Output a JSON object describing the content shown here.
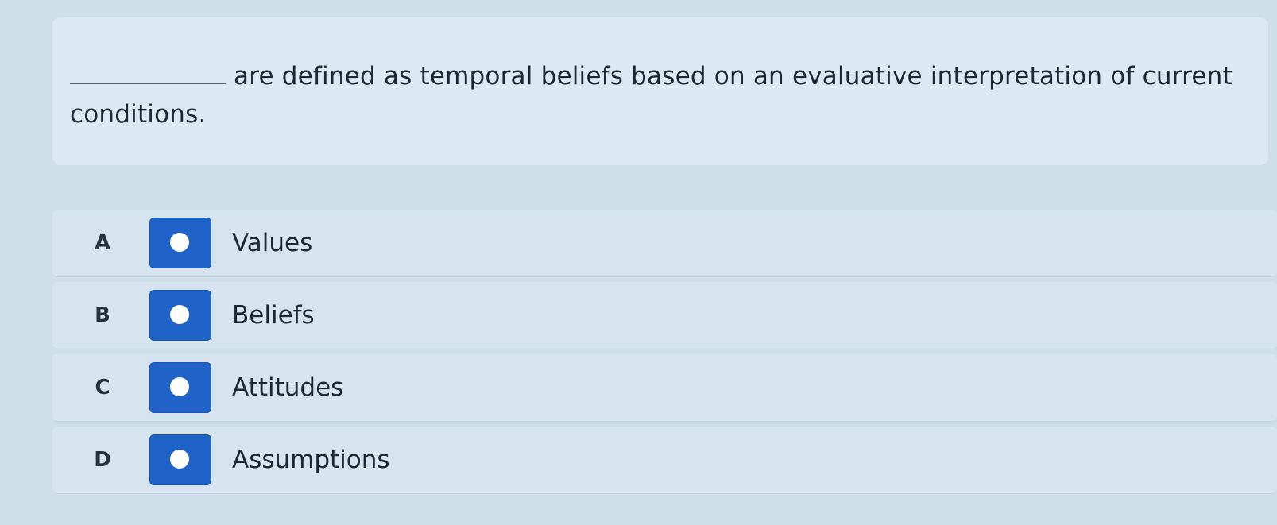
{
  "question": {
    "text": "are defined as temporal beliefs based on an evaluative interpretation of current conditions."
  },
  "options": [
    {
      "letter": "A",
      "label": "Values"
    },
    {
      "letter": "B",
      "label": "Beliefs"
    },
    {
      "letter": "C",
      "label": "Attitudes"
    },
    {
      "letter": "D",
      "label": "Assumptions"
    }
  ],
  "colors": {
    "radio_accent": "#1f63c9",
    "background": "#cfdfea"
  },
  "icons": {
    "radio": "radio-button-icon"
  }
}
